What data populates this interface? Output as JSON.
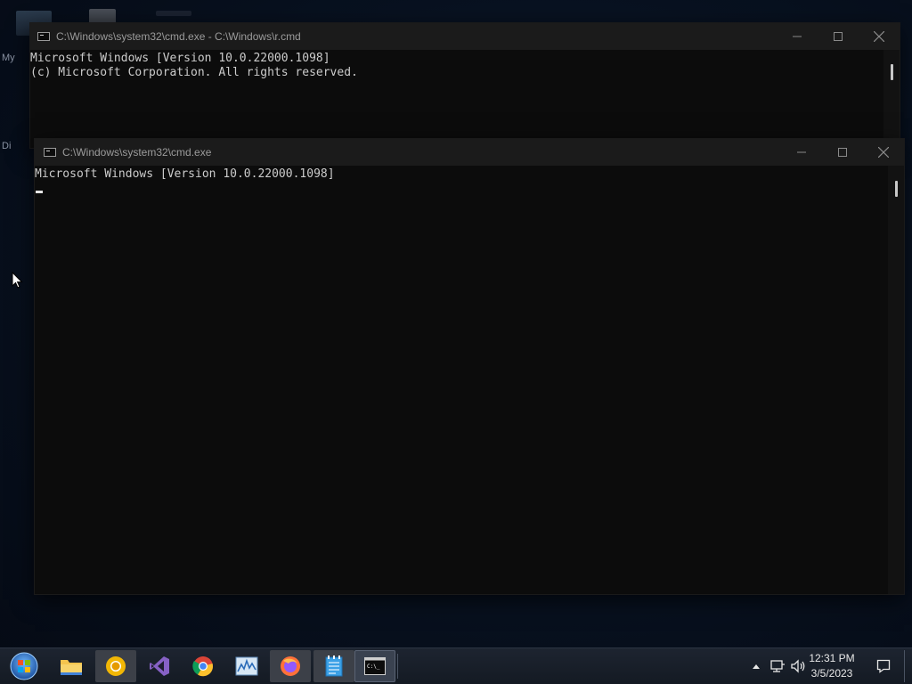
{
  "desktop": {
    "partial_label_1": "My",
    "partial_label_2": "Di"
  },
  "window_back": {
    "title": "C:\\Windows\\system32\\cmd.exe - C:\\Windows\\r.cmd",
    "lines": [
      "Microsoft Windows [Version 10.0.22000.1098]",
      "(c) Microsoft Corporation. All rights reserved."
    ]
  },
  "window_front": {
    "title": "C:\\Windows\\system32\\cmd.exe",
    "lines": [
      "Microsoft Windows [Version 10.0.22000.1098]"
    ]
  },
  "taskbar": {
    "apps": [
      {
        "name": "start-button",
        "icon": "windows-start-orb-icon"
      },
      {
        "name": "file-explorer",
        "icon": "folder-icon"
      },
      {
        "name": "chrome-canary",
        "icon": "chrome-yellow-icon"
      },
      {
        "name": "visual-studio",
        "icon": "visual-studio-icon"
      },
      {
        "name": "chrome",
        "icon": "chrome-icon"
      },
      {
        "name": "performance-monitor",
        "icon": "chart-icon"
      },
      {
        "name": "firefox",
        "icon": "firefox-icon"
      },
      {
        "name": "notepad",
        "icon": "notepad-icon"
      },
      {
        "name": "command-prompt",
        "icon": "cmd-icon"
      }
    ],
    "clock": {
      "time": "12:31 PM",
      "date": "3/5/2023"
    }
  }
}
